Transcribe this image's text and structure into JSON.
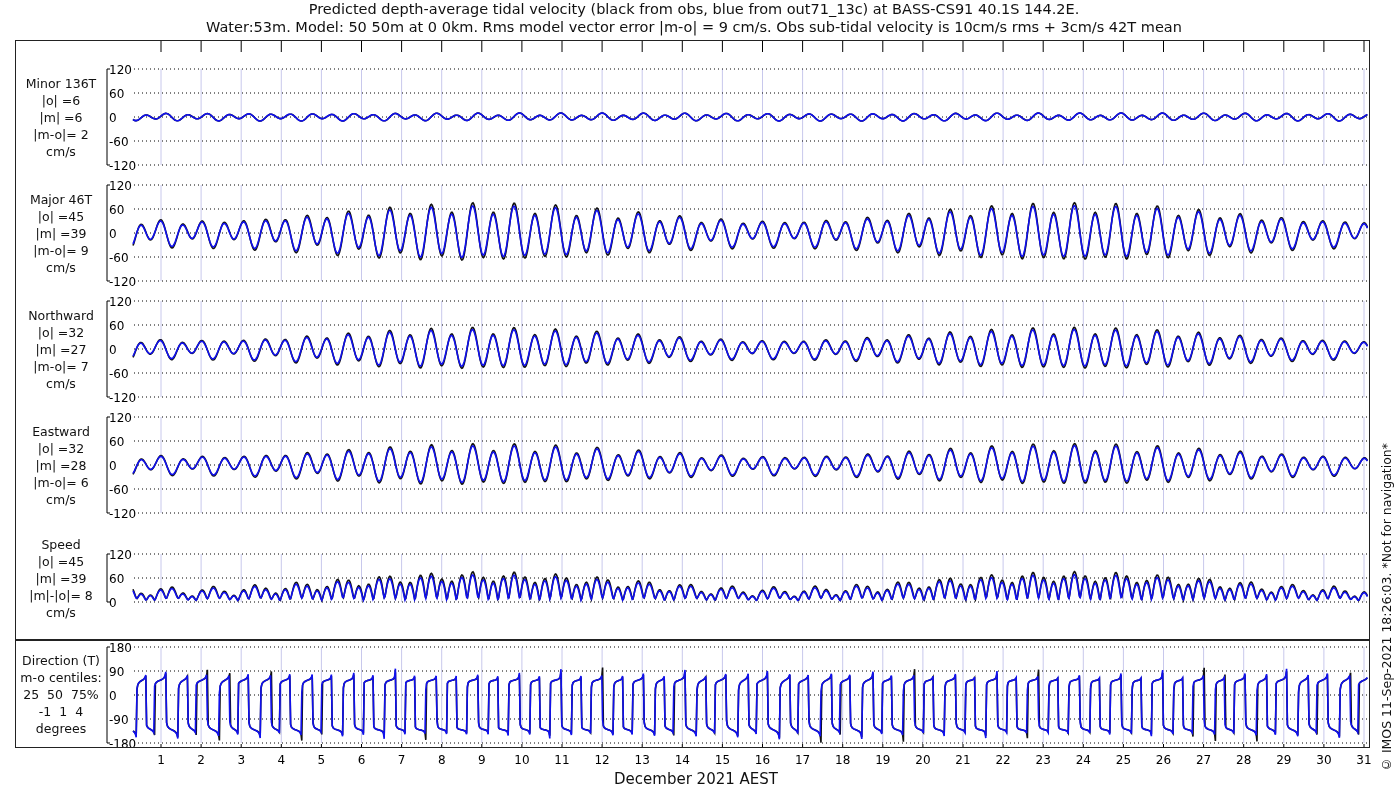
{
  "title_lines": [
    "Predicted depth-average tidal velocity (black from obs, blue from out71_13c) at BASS-CS91 40.1S 144.2E.",
    "Water:53m. Model: 50 50m at 0 0km. Rms model vector error |m-o| = 9 cm/s. Obs sub-tidal velocity is 10cm/s rms + 3cm/s 42T mean"
  ],
  "panels": [
    {
      "kind": "minor",
      "label_lines": [
        "Minor 136T",
        "|o| =6",
        "|m| =6",
        "|m-o|= 2",
        "cm/s"
      ],
      "yticks": [
        "120",
        "60",
        "0",
        "-60",
        "-120"
      ]
    },
    {
      "kind": "major",
      "label_lines": [
        "Major 46T",
        "|o| =45",
        "|m| =39",
        "|m-o|= 9",
        "cm/s"
      ],
      "yticks": [
        "120",
        "60",
        "0",
        "-60",
        "-120"
      ]
    },
    {
      "kind": "northward",
      "label_lines": [
        "Northward",
        "|o| =32",
        "|m| =27",
        "|m-o|= 7",
        "cm/s"
      ],
      "yticks": [
        "120",
        "60",
        "0",
        "-60",
        "-120"
      ]
    },
    {
      "kind": "eastward",
      "label_lines": [
        "Eastward",
        "|o| =32",
        "|m| =28",
        "|m-o|= 6",
        "cm/s"
      ],
      "yticks": [
        "120",
        "60",
        "0",
        "-60",
        "-120"
      ]
    },
    {
      "kind": "speed",
      "label_lines": [
        "Speed",
        "|o| =45",
        "|m| =39",
        "|m|-|o|= 8",
        "cm/s"
      ],
      "yticks": [
        "120",
        "60",
        "0"
      ]
    },
    {
      "kind": "direction",
      "label_lines": [
        "Direction (T)",
        "m-o centiles:",
        "25  50  75%",
        "-1  1  4",
        "degrees"
      ],
      "yticks": [
        "180",
        "90",
        "0",
        "-90",
        "-180"
      ]
    }
  ],
  "x_axis": {
    "day_labels": [
      "1",
      "2",
      "3",
      "4",
      "5",
      "6",
      "7",
      "8",
      "9",
      "10",
      "11",
      "12",
      "13",
      "14",
      "15",
      "16",
      "17",
      "18",
      "19",
      "20",
      "21",
      "22",
      "23",
      "24",
      "25",
      "26",
      "27",
      "28",
      "29",
      "30",
      "31"
    ],
    "label": "December 2021 AEST"
  },
  "side_note": "© IMOS 11-Sep-2021 18:26:03. *Not for navigation*"
}
